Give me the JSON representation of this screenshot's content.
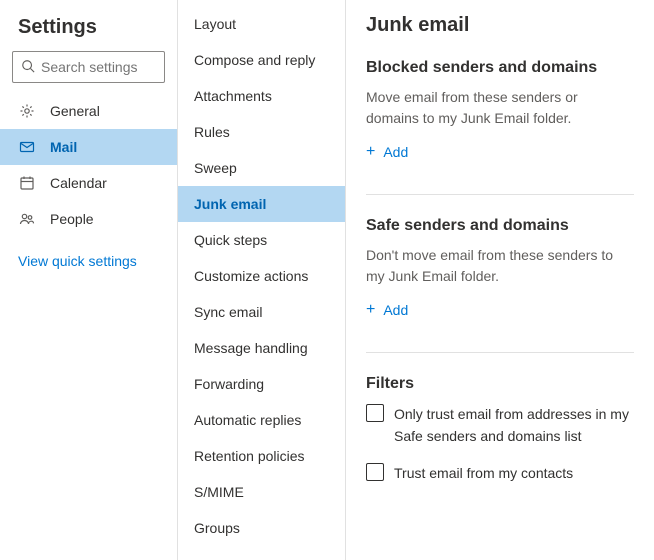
{
  "sidebar": {
    "title": "Settings",
    "search_placeholder": "Search settings",
    "view_quick": "View quick settings",
    "nav": [
      {
        "label": "General",
        "icon": "gear"
      },
      {
        "label": "Mail",
        "icon": "mail"
      },
      {
        "label": "Calendar",
        "icon": "calendar"
      },
      {
        "label": "People",
        "icon": "people"
      }
    ]
  },
  "subnav": {
    "items": [
      "Layout",
      "Compose and reply",
      "Attachments",
      "Rules",
      "Sweep",
      "Junk email",
      "Quick steps",
      "Customize actions",
      "Sync email",
      "Message handling",
      "Forwarding",
      "Automatic replies",
      "Retention policies",
      "S/MIME",
      "Groups"
    ]
  },
  "main": {
    "title": "Junk email",
    "blocked": {
      "title": "Blocked senders and domains",
      "desc": "Move email from these senders or domains to my Junk Email folder.",
      "add": "Add"
    },
    "safe": {
      "title": "Safe senders and domains",
      "desc": "Don't move email from these senders to my Junk Email folder.",
      "add": "Add"
    },
    "filters": {
      "title": "Filters",
      "check1": "Only trust email from addresses in my Safe senders and domains list",
      "check2": "Trust email from my contacts"
    }
  }
}
